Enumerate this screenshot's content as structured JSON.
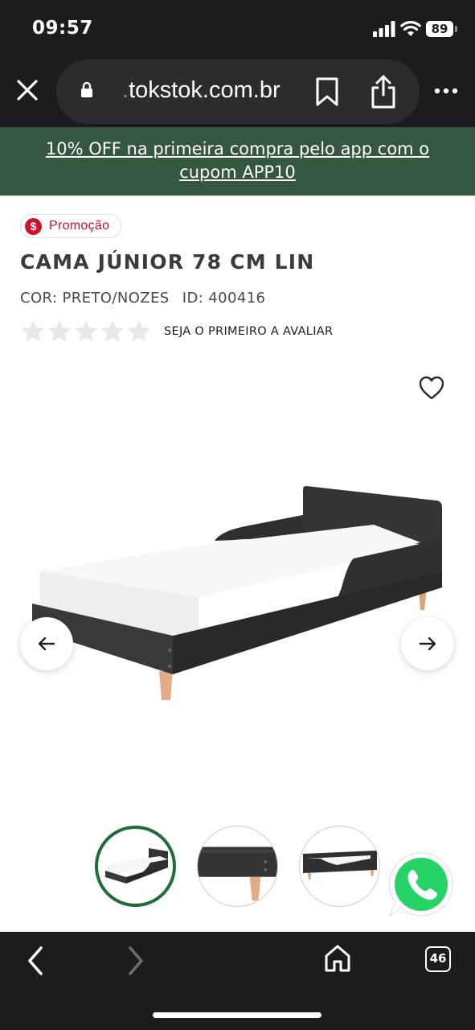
{
  "status_bar": {
    "time": "09:57",
    "battery": "89"
  },
  "browser": {
    "url_faded": ".",
    "url": "tokstok.com.br"
  },
  "promo_banner": {
    "text": "10% OFF na primeira compra pelo app com o cupom APP10",
    "background": "#35573f"
  },
  "product": {
    "badge": "Promoção",
    "badge_icon": "$",
    "title": "CAMA JÚNIOR 78 CM LIN",
    "color": "COR: PRETO/NOZES",
    "id": "ID: 400416",
    "rating_stars": 0,
    "rating_max": 5,
    "rating_cta": "SEJA O PRIMEIRO A AVALIAR",
    "favorited": false
  },
  "gallery": {
    "thumbnails": [
      "bed-front-view",
      "bed-detail-leg",
      "bed-side-view"
    ],
    "active_index": 0
  },
  "bottom_nav": {
    "tabs_count": "46"
  },
  "colors": {
    "accent_green": "#1f6b3a",
    "promo_red": "#c8102e",
    "whatsapp_green": "#25d366"
  }
}
